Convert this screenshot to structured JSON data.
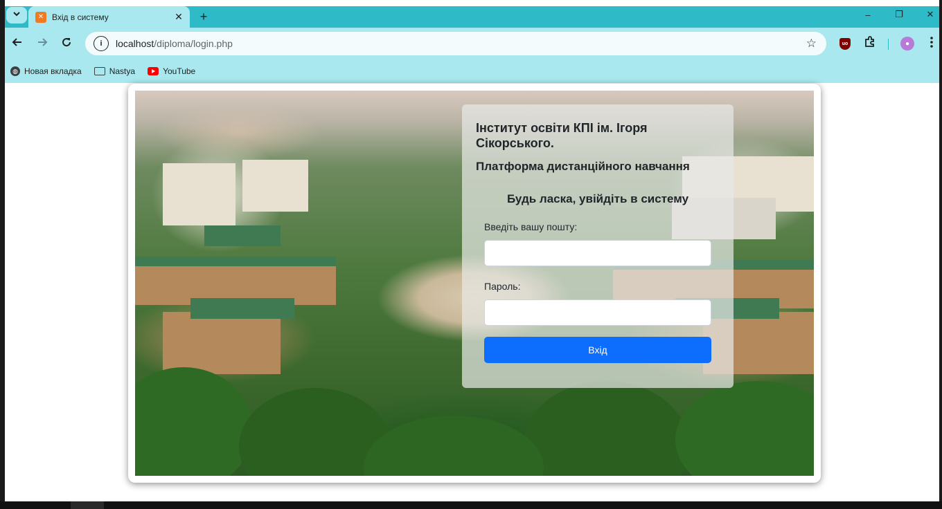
{
  "browser": {
    "tab": {
      "title": "Вхід в систему",
      "favicon": "xampp-icon"
    },
    "window_controls": {
      "minimize": "–",
      "restore": "❐",
      "close": "✕"
    },
    "toolbar": {
      "url_host": "localhost",
      "url_path": "/diploma/login.php"
    },
    "bookmarks": [
      {
        "label": "Новая вкладка",
        "icon": "globe-icon"
      },
      {
        "label": "Nastya",
        "icon": "folder-icon"
      },
      {
        "label": "YouTube",
        "icon": "youtube-icon"
      }
    ],
    "colors": {
      "tabstrip": "#2fbac8",
      "toolbar": "#a8e8ee",
      "omnibox": "#f4fbfc"
    }
  },
  "login": {
    "institute": "Інститут освіти КПІ ім. Ігоря Сікорського.",
    "platform": "Платформа дистанційного навчання",
    "heading": "Будь ласка, увійдіть в систему",
    "email_label": "Введіть вашу пошту:",
    "email_value": "",
    "password_label": "Пароль:",
    "password_value": "",
    "submit_label": "Вхід",
    "colors": {
      "button": "#0d6efd",
      "text": "#212529"
    }
  }
}
